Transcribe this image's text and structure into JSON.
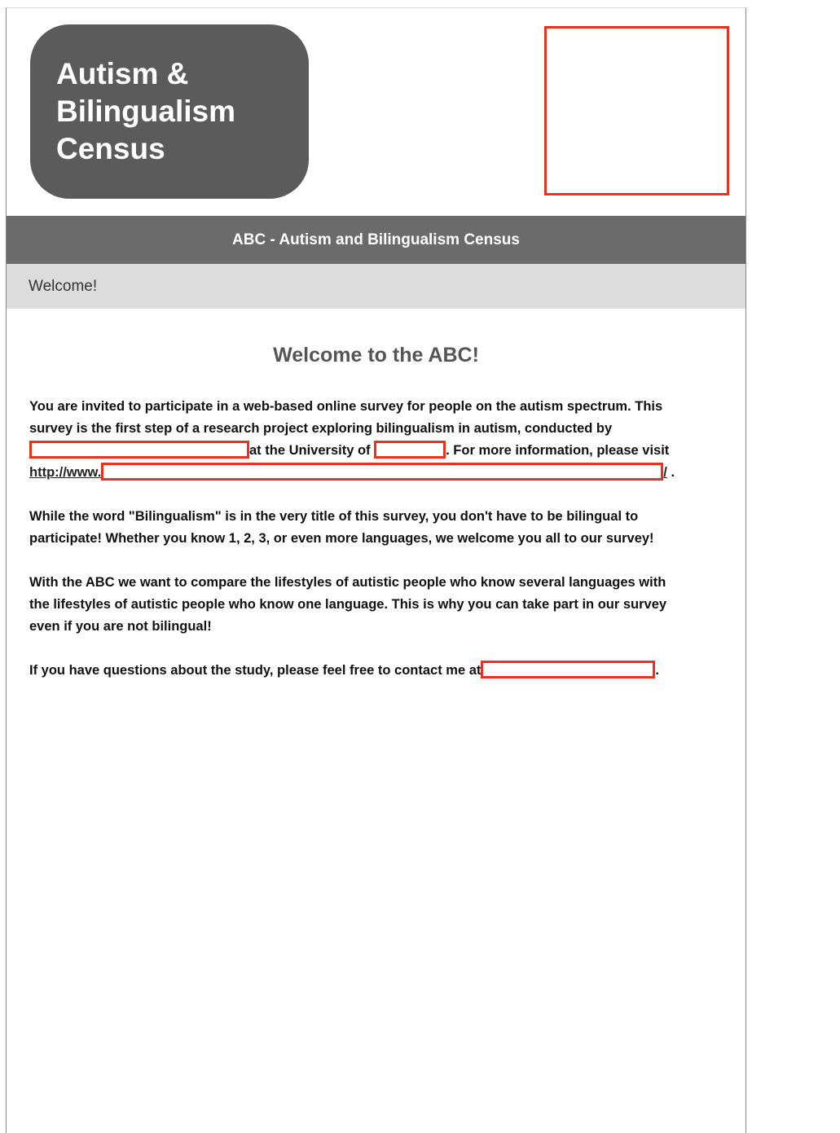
{
  "logo": {
    "line1": "Autism &",
    "line2": "Bilingualism",
    "line3": "Census"
  },
  "header": {
    "title": "ABC - Autism and Bilingualism Census"
  },
  "section": {
    "label": "Welcome!"
  },
  "main": {
    "heading": "Welcome to the ABC!",
    "p1": {
      "line1": "You are invited to participate in a web-based online survey for people on the autism spectrum. This",
      "line2": "survey is the first step of a research project exploring bilingualism in autism, conducted by",
      "line3_a": "at the University of",
      "line3_b": ". For more information, please visit",
      "link_prefix": "http://www.",
      "link_suffix": "/",
      "line4_end": " ."
    },
    "p2": {
      "line1": "While the word \"Bilingualism\" is in the very title of this survey, you don't have to be bilingual to",
      "line2": "participate! Whether you know 1, 2, 3, or even more languages, we welcome you all to our survey!"
    },
    "p3": {
      "line1": "With the ABC we want to compare the lifestyles of autistic people who know several languages with",
      "line2": "the lifestyles of autistic people who know one language. This is why you can take part in our survey",
      "line3": "even if you are not bilingual!"
    },
    "p4": {
      "text": "If you have questions about the study, please feel free to contact me at",
      "end": "."
    }
  },
  "colors": {
    "logo_bg": "#5b5b5b",
    "title_bar": "#6b6b6b",
    "section_bar": "#dcdcdc",
    "redaction": "#e8321c"
  }
}
